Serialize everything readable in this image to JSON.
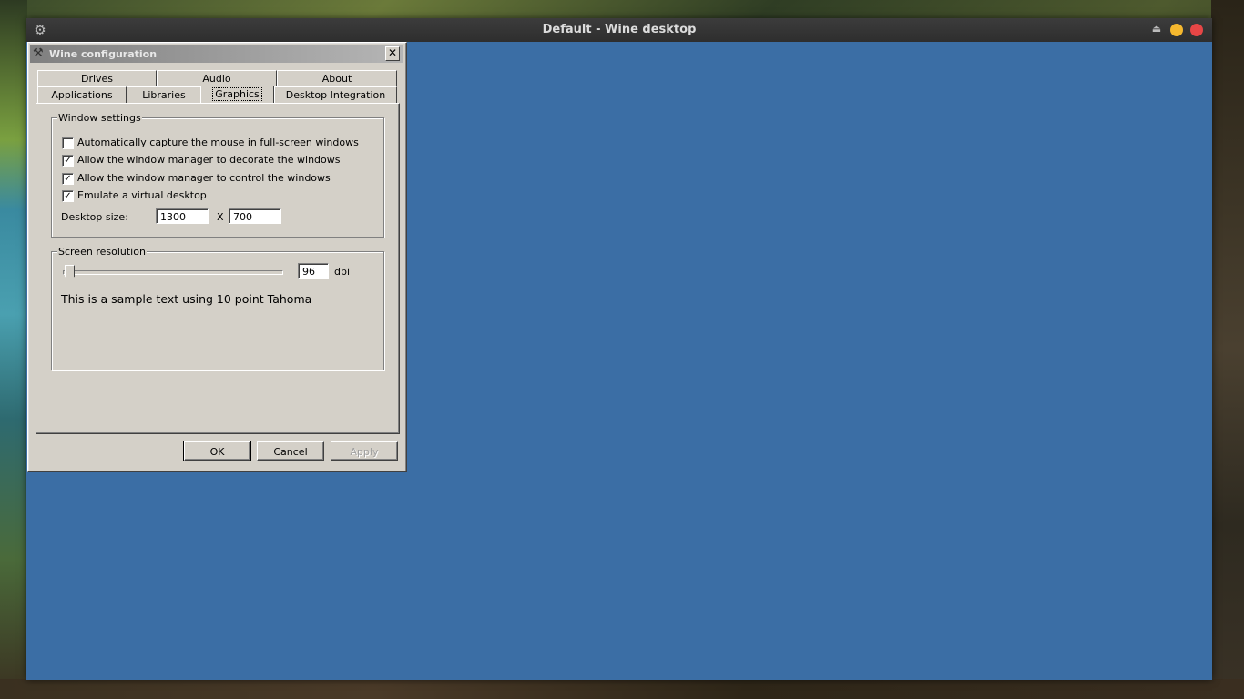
{
  "host_window": {
    "title": "Default - Wine desktop",
    "background_color": "#3b6ea5"
  },
  "dialog": {
    "title": "Wine configuration",
    "close_label": "✕",
    "tabs_row1": [
      {
        "label": "Drives"
      },
      {
        "label": "Audio"
      },
      {
        "label": "About"
      }
    ],
    "tabs_row2": [
      {
        "label": "Applications"
      },
      {
        "label": "Libraries"
      },
      {
        "label": "Graphics",
        "active": true
      },
      {
        "label": "Desktop Integration"
      }
    ],
    "window_settings": {
      "label": "Window settings",
      "checkboxes": [
        {
          "label": "Automatically capture the mouse in full-screen windows",
          "checked": false
        },
        {
          "label": "Allow the window manager to decorate the windows",
          "checked": true
        },
        {
          "label": "Allow the window manager to control the windows",
          "checked": true
        },
        {
          "label": "Emulate a virtual desktop",
          "checked": true
        }
      ],
      "desktop_size_label": "Desktop size:",
      "width": "1300",
      "separator": "X",
      "height": "700"
    },
    "screen_resolution": {
      "label": "Screen resolution",
      "dpi_value": "96",
      "dpi_unit": "dpi",
      "sample_text": "This is a sample text using 10 point Tahoma"
    },
    "buttons": {
      "ok": "OK",
      "cancel": "Cancel",
      "apply": "Apply"
    }
  }
}
